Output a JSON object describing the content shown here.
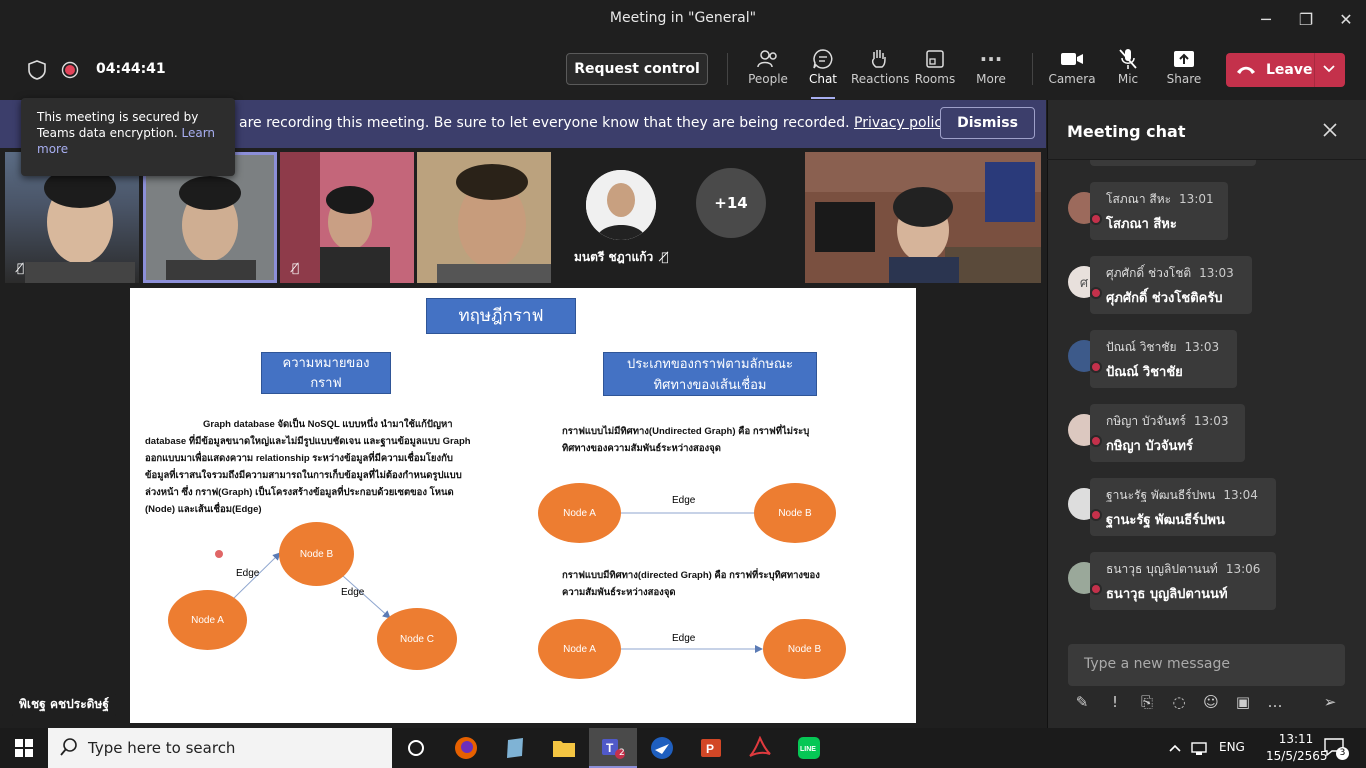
{
  "window": {
    "title": "Meeting in \"General\"",
    "minimize": "─",
    "maximize": "❐",
    "close": "✕"
  },
  "toolbar": {
    "timer": "04:44:41",
    "request_control": "Request control",
    "people": "People",
    "chat": "Chat",
    "reactions": "Reactions",
    "rooms": "Rooms",
    "more": "More",
    "camera": "Camera",
    "mic": "Mic",
    "share": "Share",
    "leave": "Leave",
    "more_icon": "···"
  },
  "banner": {
    "message": "are recording this meeting. Be sure to let everyone know that they are being recorded.",
    "link": "Privacy policy",
    "dismiss": "Dismiss"
  },
  "tooltip": {
    "text": "This meeting is secured by Teams data encryption.",
    "link": "Learn more"
  },
  "participants": {
    "named": "มนตรี ชฎาแก้ว",
    "overflow": "+14",
    "speaker_name": "พิเชฐ คชประดิษฐ์"
  },
  "slide": {
    "title": "ทฤษฎีกราฟ",
    "left_heading_1": "ความหมายของ",
    "left_heading_2": "กราฟ",
    "right_heading_1": "ประเภทของกราฟตามลักษณะ",
    "right_heading_2": "ทิศทางของเส้นเชื่อม",
    "para_lines": [
      "Graph database จัดเป็น NoSQL แบบหนึ่ง นำมาใช้แก้ปัญหา",
      "database ที่มีข้อมูลขนาดใหญ่และไม่มีรูปแบบชัดเจน และฐานข้อมูลแบบ Graph",
      "ออกแบบมาเพื่อแสดงความ relationship ระหว่างข้อมูลที่มีความเชื่อมโยงกับ",
      "ข้อมูลที่เราสนใจรวมถึงมีความสามารถในการเก็บข้อมูลที่ไม่ต้องกำหนดรูปแบบ",
      "ล่วงหน้า ซึ่ง กราฟ(Graph) เป็นโครงสร้างข้อมูลที่ประกอบด้วยเซตของ โหนด",
      "(Node) และเส้นเชื่อม(Edge)"
    ],
    "undirected_1": "กราฟแบบไม่มีทิศทาง(Undirected Graph) คือ กราฟที่ไม่ระบุ",
    "undirected_2": "ทิศทางของความสัมพันธ์ระหว่างสองจุด",
    "directed_1": "กราฟแบบมีทิศทาง(directed Graph) คือ กราฟที่ระบุทิศทางของ",
    "directed_2": "ความสัมพันธ์ระหว่างสองจุด",
    "node_a": "Node A",
    "node_b": "Node B",
    "node_c": "Node C",
    "edge": "Edge"
  },
  "chat": {
    "title": "Meeting chat",
    "messages": [
      {
        "name": "โสภณา สีหะ",
        "time": "13:01",
        "text": "โสภณา สีหะ",
        "initial": ""
      },
      {
        "name": "ศุภศักดิ์ ช่วงโชติ",
        "time": "13:03",
        "text": "ศุภศักดิ์ ช่วงโชติครับ",
        "initial": "ศ"
      },
      {
        "name": "ปัณณ์ วิชาชัย",
        "time": "13:03",
        "text": "ปัณณ์ วิชาชัย",
        "initial": ""
      },
      {
        "name": "กษิญา บัวจันทร์",
        "time": "13:03",
        "text": "กษิญา บัวจันทร์",
        "initial": ""
      },
      {
        "name": "ฐานะรัฐ พัฒนธีร์ปพน",
        "time": "13:04",
        "text": "ฐานะรัฐ พัฒนธีร์ปพน",
        "initial": ""
      },
      {
        "name": "ธนาวุธ บุญลิปตานนท์",
        "time": "13:06",
        "text": "ธนาวุธ บุญลิปตานนท์",
        "initial": ""
      }
    ],
    "compose_placeholder": "Type a new message"
  },
  "taskbar": {
    "search_placeholder": "Type here to search",
    "teams_badge": "2",
    "language": "ENG",
    "time": "13:11",
    "date": "15/5/2565",
    "notifications": "3",
    "line_label": "LINE"
  }
}
